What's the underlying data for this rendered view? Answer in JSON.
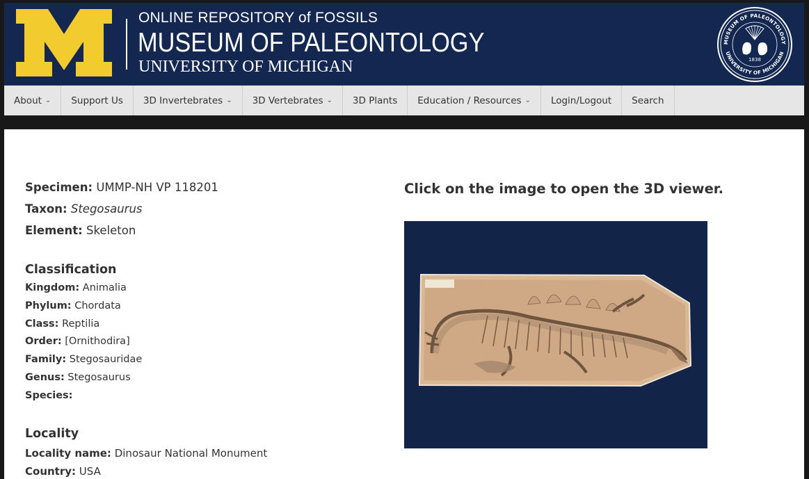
{
  "header": {
    "line1": "ONLINE REPOSITORY of FOSSILS",
    "line2": "MUSEUM OF PALEONTOLOGY",
    "line3": "UNIVERSITY OF MICHIGAN",
    "seal_top_text": "MUSEUM OF PALEONTOLOGY",
    "seal_bottom_text": "UNIVERSITY OF MICHIGAN",
    "seal_year": "1838",
    "colors": {
      "navy": "#132750",
      "maize": "#f2cb2f"
    }
  },
  "nav": {
    "items": [
      {
        "label": "About",
        "dropdown": true
      },
      {
        "label": "Support Us",
        "dropdown": false
      },
      {
        "label": "3D Invertebrates",
        "dropdown": true
      },
      {
        "label": "3D Vertebrates",
        "dropdown": true
      },
      {
        "label": "3D Plants",
        "dropdown": false
      },
      {
        "label": "Education / Resources",
        "dropdown": true
      },
      {
        "label": "Login/Logout",
        "dropdown": false
      },
      {
        "label": "Search",
        "dropdown": false
      }
    ]
  },
  "specimen": {
    "specimen_label": "Specimen:",
    "specimen_value": "UMMP-NH VP 118201",
    "taxon_label": "Taxon:",
    "taxon_value": "Stegosaurus",
    "element_label": "Element:",
    "element_value": "Skeleton"
  },
  "classification": {
    "title": "Classification",
    "rows": [
      {
        "label": "Kingdom:",
        "value": "Animalia"
      },
      {
        "label": "Phylum:",
        "value": "Chordata"
      },
      {
        "label": "Class:",
        "value": "Reptilia"
      },
      {
        "label": "Order:",
        "value": "[Ornithodira]"
      },
      {
        "label": "Family:",
        "value": "Stegosauridae"
      },
      {
        "label": "Genus:",
        "value": "Stegosaurus"
      },
      {
        "label": "Species:",
        "value": ""
      }
    ]
  },
  "locality": {
    "title": "Locality",
    "rows": [
      {
        "label": "Locality name:",
        "value": "Dinosaur National Monument"
      },
      {
        "label": "Country:",
        "value": "USA"
      }
    ]
  },
  "viewer": {
    "prompt": "Click on the image to open the 3D viewer."
  }
}
